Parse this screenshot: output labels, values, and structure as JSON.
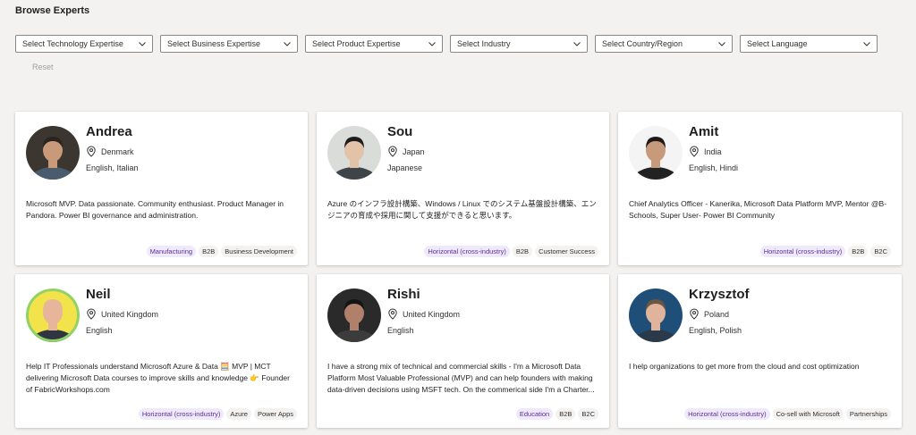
{
  "page": {
    "title": "Browse Experts"
  },
  "filters": [
    {
      "label": "Select Technology Expertise"
    },
    {
      "label": "Select Business Expertise"
    },
    {
      "label": "Select Product Expertise"
    },
    {
      "label": "Select Industry"
    },
    {
      "label": "Select Country/Region"
    },
    {
      "label": "Select Language"
    }
  ],
  "reset_label": "Reset",
  "experts": [
    {
      "name": "Andrea",
      "country": "Denmark",
      "languages": "English, Italian",
      "bio": "Microsoft MVP. Data passionate. Community enthusiast. Product Manager in Pandora. Power BI governance and administration.",
      "tags": [
        "Manufacturing",
        "B2B",
        "Business Development"
      ],
      "avatar": {
        "bg": "#3b3630",
        "skin": "#c99a7a",
        "hair": "#2a241f",
        "shirt": "#4a5b6e"
      }
    },
    {
      "name": "Sou",
      "country": "Japan",
      "languages": "Japanese",
      "bio": "Azure のインフラ設計構築、Windows / Linux でのシステム基盤設計構築、エンジニアの育成や採用に関して支援ができると思います。",
      "tags": [
        "Horizontal (cross-industry)",
        "B2B",
        "Customer Success"
      ],
      "avatar": {
        "bg": "#d9dcd8",
        "skin": "#e2c3a8",
        "hair": "#1c1c1c",
        "shirt": "#3f4448"
      }
    },
    {
      "name": "Amit",
      "country": "India",
      "languages": "English, Hindi",
      "bio": "Chief Analytics Officer - Kanerika, Microsoft Data Platform MVP, Mentor @B-Schools, Super User- Power BI Community",
      "tags": [
        "Horizontal (cross-industry)",
        "B2B",
        "B2C"
      ],
      "avatar": {
        "bg": "#f4f4f4",
        "skin": "#c79a7c",
        "hair": "#1f1a17",
        "shirt": "#222222"
      }
    },
    {
      "name": "Neil",
      "country": "United Kingdom",
      "languages": "English",
      "bio": "Help IT Professionals understand Microsoft Azure & Data 🧮 MVP | MCT delivering Microsoft Data courses to improve skills and knowledge 👉 Founder of FabricWorkshops.com",
      "tags": [
        "Horizontal (cross-industry)",
        "Azure",
        "Power Apps"
      ],
      "avatar": {
        "bg": "#f2e34a",
        "skin": "#e6b59a",
        "hair": "#e6b59a",
        "shirt": "#2f3640",
        "ring": "#8fd16a"
      }
    },
    {
      "name": "Rishi",
      "country": "United Kingdom",
      "languages": "English",
      "bio": "I have a strong mix of technical and commercial skills - I'm a Microsoft Data Platform Most Valuable Professional (MVP) and can help founders with making data-driven decisions using MSFT tech. On the commerical side I'm a Charter...",
      "tags": [
        "Education",
        "B2B",
        "B2C"
      ],
      "avatar": {
        "bg": "#2b2a2a",
        "skin": "#b0806a",
        "hair": "#141414",
        "shirt": "#3c3c3c"
      }
    },
    {
      "name": "Krzysztof",
      "country": "Poland",
      "languages": "English, Polish",
      "bio": "I help organizations to get more from the cloud and cost optimization",
      "tags": [
        "Horizontal (cross-industry)",
        "Co-sell with Microsoft",
        "Partnerships"
      ],
      "avatar": {
        "bg": "#1f4e79",
        "skin": "#e0b49c",
        "hair": "#6b5640",
        "shirt": "#2b3a4a"
      }
    }
  ]
}
